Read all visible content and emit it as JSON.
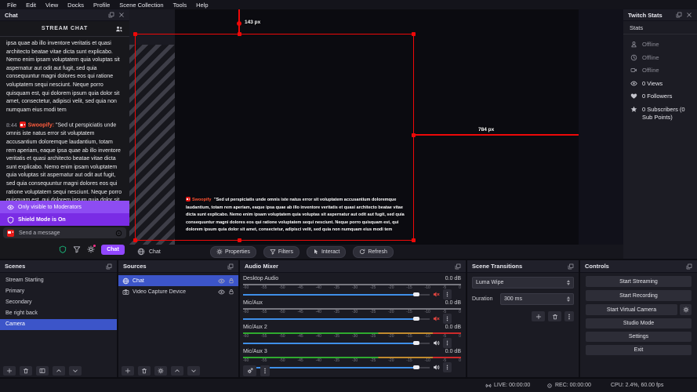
{
  "menu": {
    "items": [
      "File",
      "Edit",
      "View",
      "Docks",
      "Profile",
      "Scene Collection",
      "Tools",
      "Help"
    ]
  },
  "chat": {
    "dock_title": "Chat",
    "header": "STREAM CHAT",
    "message_prev": "ipsa quae ab illo inventore veritatis et quasi architecto beatae vitae dicta sunt explicabo. Nemo enim ipsam voluptatem quia voluptas sit aspernatur aut odit aut fugit, sed quia consequuntur magni dolores eos qui ratione voluptatem sequi nesciunt. Neque porro quisquam est, qui dolorem ipsum quia dolor sit amet, consectetur, adipisci velit, sed quia non numquam eius modi tem",
    "message": {
      "time": "8:44",
      "user": "Swoopify:",
      "text": "\"Sed ut perspiciatis unde omnis iste natus error sit voluptatem accusantium doloremque laudantium, totam rem aperiam, eaque ipsa quae ab illo inventore veritatis et quasi architecto beatae vitae dicta sunt explicabo. Nemo enim ipsam voluptatem quia voluptas sit aspernatur aut odit aut fugit, sed quia consequuntur magni dolores eos qui ratione voluptatem sequi nesciunt. Neque porro quisquam est, qui dolorem ipsum quia dolor sit amet, consectetur, adipisci velit, sed quia non numquam eius modi tem"
    },
    "notice_moderators": "Only visible to Moderators",
    "notice_shield": "Shield Mode is On",
    "input_placeholder": "Send a message",
    "send_button": "Chat"
  },
  "preview": {
    "guide_top_label": "143 px",
    "guide_side_label": "784 px",
    "overlay_user": "Swoopify",
    "overlay_text": "\"Sed ut perspiciatis unde omnis iste natus error sit voluptatem accusantium doloremque laudantium, totam rem aperiam, eaque ipsa quae ab illo inventore veritatis et quasi architecto beatae vitae dicta sunt explicabo. Nemo enim ipsam voluptatem quia voluptas sit aspernatur aut odit aut fugit, sed quia consequuntur magni dolores eos qui ratione voluptatem sequi nesciunt. Neque porro quisquam est, qui dolorem ipsum quia dolor sit amet, consectetur, adipisci velit, sed quia non numquam eius modi tem",
    "source_label": "Chat",
    "buttons": {
      "properties": "Properties",
      "filters": "Filters",
      "interact": "Interact",
      "refresh": "Refresh"
    }
  },
  "twitch_stats": {
    "dock_title": "Twitch Stats",
    "header": "Stats",
    "rows": [
      {
        "label": "Offline"
      },
      {
        "label": "Offline"
      },
      {
        "label": "Offline"
      },
      {
        "label": "0 Views"
      },
      {
        "label": "0 Followers"
      },
      {
        "label": "0 Subscribers (0 Sub Points)"
      }
    ]
  },
  "scenes": {
    "dock_title": "Scenes",
    "items": [
      "Stream Starting",
      "Primary",
      "Secondary",
      "Be right back",
      "Camera"
    ],
    "selected": "Camera"
  },
  "sources": {
    "dock_title": "Sources",
    "rows": [
      {
        "name": "Chat",
        "selected": true
      },
      {
        "name": "Video Capture Device",
        "selected": false
      }
    ]
  },
  "audio_mixer": {
    "dock_title": "Audio Mixer",
    "tick_labels": [
      "-60",
      "-55",
      "-50",
      "-45",
      "-40",
      "-35",
      "-30",
      "-25",
      "-20",
      "-15",
      "-10",
      "-5",
      "0"
    ],
    "channels": [
      {
        "name": "Desktop Audio",
        "level": "0.0 dB",
        "muted": true
      },
      {
        "name": "Mic/Aux",
        "level": "0.0 dB",
        "muted": true
      },
      {
        "name": "Mic/Aux 2",
        "level": "0.0 dB",
        "muted": false
      },
      {
        "name": "Mic/Aux 3",
        "level": "0.0 dB",
        "muted": false
      }
    ]
  },
  "transitions": {
    "dock_title": "Scene Transitions",
    "transition": "Luma Wipe",
    "duration_label": "Duration",
    "duration_value": "300 ms"
  },
  "controls": {
    "dock_title": "Controls",
    "buttons": [
      "Start Streaming",
      "Start Recording",
      "Start Virtual Camera",
      "Studio Mode",
      "Settings",
      "Exit"
    ]
  },
  "status": {
    "live": "LIVE: 00:00:00",
    "rec": "REC: 00:00:00",
    "cpu": "CPU: 2.4%, 60.00 fps"
  },
  "colors": {
    "accent_blue": "#3c55c9",
    "twitch_purple": "#9147ff",
    "selection_red": "#ee0808",
    "meter_green": "#2faa2f",
    "meter_yellow": "#c08a2e",
    "meter_red": "#cc2a2a"
  }
}
